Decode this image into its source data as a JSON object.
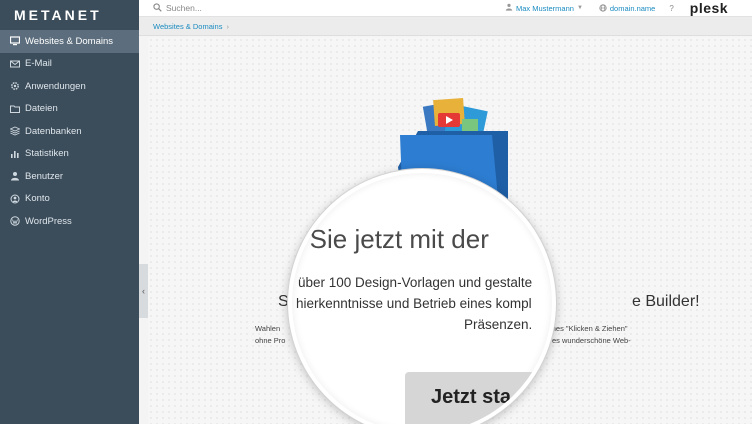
{
  "brand": "METANET",
  "sidebar": {
    "items": [
      {
        "label": "Websites & Domains",
        "icon": "monitor-icon",
        "active": true
      },
      {
        "label": "E-Mail",
        "icon": "mail-icon"
      },
      {
        "label": "Anwendungen",
        "icon": "gear-icon"
      },
      {
        "label": "Dateien",
        "icon": "folder-icon"
      },
      {
        "label": "Datenbanken",
        "icon": "database-icon"
      },
      {
        "label": "Statistiken",
        "icon": "bar-chart-icon"
      },
      {
        "label": "Benutzer",
        "icon": "user-icon"
      },
      {
        "label": "Konto",
        "icon": "account-icon"
      },
      {
        "label": "WordPress",
        "icon": "wordpress-icon"
      }
    ]
  },
  "header": {
    "search_placeholder": "Suchen...",
    "user_name": "Max Mustermann",
    "domain": "domain.name",
    "help": "?",
    "product": "plesk"
  },
  "breadcrumb": {
    "item": "Websites & Domains",
    "separator": "›"
  },
  "collapse_glyph": "‹",
  "main": {
    "bg_title": "n Sie jetzt mit der",
    "bg_sub_left": "Sta",
    "bg_sub_right": "e Builder!",
    "bg_desc_left1": "Wahlen",
    "bg_desc_left2": "ohne Pro",
    "bg_desc_right1": "ches \"Klicken & Ziehen\"",
    "bg_desc_right2": "es wunderschöne Web-",
    "lens_title": "n Sie jetzt mit der",
    "lens_line1": "über 100 Design-Vorlagen und gestalte",
    "lens_line2": "hierkenntnisse und Betrieb eines kompl",
    "lens_line3": "Präsenzen.",
    "cta_label": "Jetzt sta"
  },
  "colors": {
    "sidebar_bg": "#3b4c5a",
    "sidebar_active": "#5c6e7d",
    "link": "#1b8bc0",
    "logo_blue": "#2d7dd2"
  }
}
